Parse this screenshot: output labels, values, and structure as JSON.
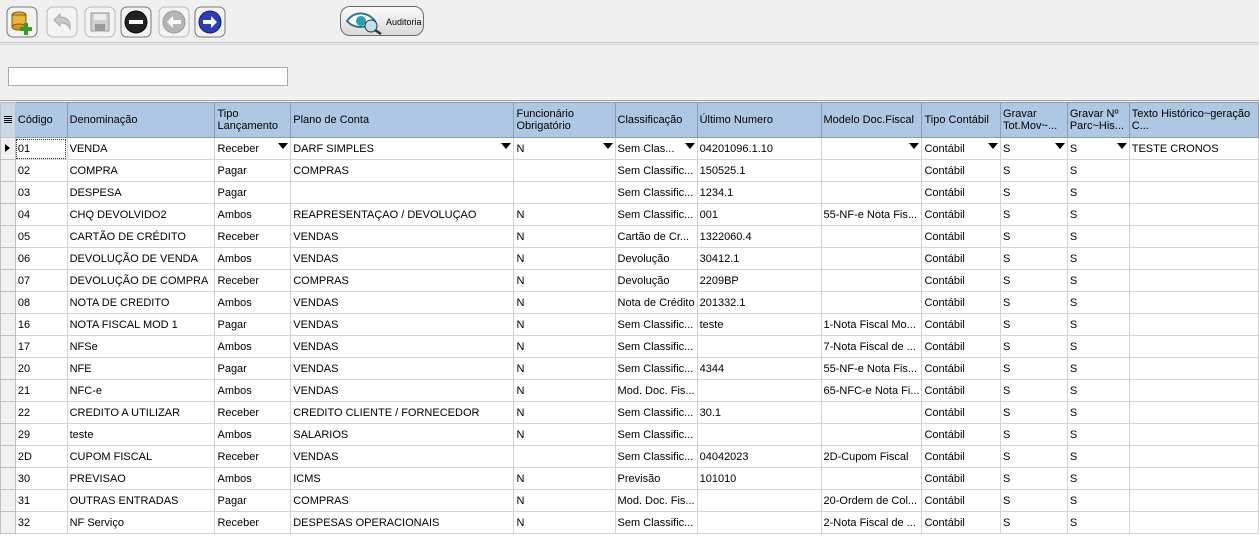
{
  "toolbar": {
    "audit_label": "Auditoria",
    "icons": [
      "database-add-icon",
      "undo-icon",
      "save-icon",
      "remove-icon",
      "back-icon",
      "forward-icon",
      "eye-audit-icon"
    ]
  },
  "filter": {
    "value": ""
  },
  "grid": {
    "headers": [
      "Código",
      "Denominação",
      "Tipo Lançamento",
      "Plano de Conta",
      "Funcionário Obrigatório",
      "Classificação",
      "Último Numero",
      "Modelo Doc.Fiscal",
      "Tipo Contábil",
      "Gravar Tot.Mov~...",
      "Gravar Nº Parc~His...",
      "Texto Histórico~geração C..."
    ],
    "rows": [
      [
        "01",
        "VENDA",
        "Receber",
        "DARF SIMPLES",
        "N",
        "Sem Clas...",
        "04201096.1.10",
        "",
        "Contábil",
        "S",
        "S",
        "TESTE CRONOS"
      ],
      [
        "02",
        "COMPRA",
        "Pagar",
        "COMPRAS",
        "",
        "Sem Classific...",
        "150525.1",
        "",
        "Contábil",
        "S",
        "S",
        ""
      ],
      [
        "03",
        "DESPESA",
        "Pagar",
        "",
        "",
        "Sem Classific...",
        "1234.1",
        "",
        "Contábil",
        "S",
        "S",
        ""
      ],
      [
        "04",
        "CHQ DEVOLVIDO2",
        "Ambos",
        "REAPRESENTAÇAO / DEVOLUÇAO",
        "N",
        "Sem Classific...",
        "001",
        "55-NF-e Nota Fis...",
        "Contábil",
        "S",
        "S",
        ""
      ],
      [
        "05",
        "CARTÃO DE CRÉDITO",
        "Receber",
        "VENDAS",
        "N",
        "Cartão de Cr...",
        "1322060.4",
        "",
        "Contábil",
        "S",
        "S",
        ""
      ],
      [
        "06",
        "DEVOLUÇÃO DE VENDA",
        "Ambos",
        "VENDAS",
        "N",
        "Devolução",
        "30412.1",
        "",
        "Contábil",
        "S",
        "S",
        ""
      ],
      [
        "07",
        "DEVOLUÇÃO DE COMPRA",
        "Receber",
        "COMPRAS",
        "N",
        "Devolução",
        "2209BP",
        "",
        "Contábil",
        "S",
        "S",
        ""
      ],
      [
        "08",
        "NOTA DE CREDITO",
        "Ambos",
        "VENDAS",
        "N",
        "Nota de Crédito",
        "201332.1",
        "",
        "Contábil",
        "S",
        "S",
        ""
      ],
      [
        "16",
        "NOTA FISCAL MOD 1",
        "Pagar",
        "VENDAS",
        "N",
        "Sem Classific...",
        "teste",
        "1-Nota Fiscal Mo...",
        "Contábil",
        "S",
        "S",
        ""
      ],
      [
        "17",
        "NFSe",
        "Ambos",
        "VENDAS",
        "N",
        "Sem Classific...",
        "",
        "7-Nota Fiscal de ...",
        "Contábil",
        "S",
        "S",
        ""
      ],
      [
        "20",
        "NFE",
        "Pagar",
        "VENDAS",
        "N",
        "Sem Classific...",
        "4344",
        "55-NF-e Nota Fis...",
        "Contábil",
        "S",
        "S",
        ""
      ],
      [
        "21",
        "NFC-e",
        "Ambos",
        "VENDAS",
        "N",
        "Mod. Doc. Fis...",
        "",
        "65-NFC-e Nota Fi...",
        "Contábil",
        "S",
        "S",
        ""
      ],
      [
        "22",
        "CREDITO A UTILIZAR",
        "Receber",
        "CREDITO CLIENTE / FORNECEDOR",
        "N",
        "Sem Classific...",
        "30.1",
        "",
        "Contábil",
        "S",
        "S",
        ""
      ],
      [
        "29",
        "teste",
        "Ambos",
        "SALARIOS",
        "N",
        "Sem Classific...",
        "",
        "",
        "Contábil",
        "S",
        "S",
        ""
      ],
      [
        "2D",
        "CUPOM FISCAL",
        "Receber",
        "VENDAS",
        "",
        "Sem Classific...",
        "04042023",
        "2D-Cupom Fiscal",
        "Contábil",
        "S",
        "S",
        ""
      ],
      [
        "30",
        "PREVISAO",
        "Ambos",
        "ICMS",
        "N",
        "Previsão",
        "101010",
        "",
        "Contábil",
        "S",
        "S",
        ""
      ],
      [
        "31",
        "OUTRAS ENTRADAS",
        "Pagar",
        "COMPRAS",
        "N",
        "Mod. Doc. Fis...",
        "",
        "20-Ordem de Col...",
        "Contábil",
        "S",
        "S",
        ""
      ],
      [
        "32",
        "NF Serviço",
        "Receber",
        "DESPESAS OPERACIONAIS",
        "N",
        "Sem Classific...",
        "",
        "2-Nota Fiscal de ...",
        "Contábil",
        "S",
        "S",
        ""
      ]
    ]
  }
}
